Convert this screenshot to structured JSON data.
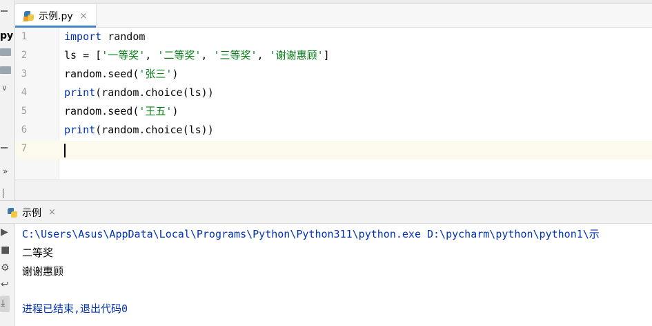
{
  "sidebar": {
    "project_label": "py"
  },
  "editor": {
    "tab": {
      "label": "示例.py",
      "close": "×"
    },
    "lines": [
      {
        "num": "1",
        "parts": [
          {
            "t": "import",
            "c": "kw"
          },
          {
            "t": " random",
            "c": ""
          }
        ]
      },
      {
        "num": "2",
        "parts": [
          {
            "t": "ls = [",
            "c": ""
          },
          {
            "t": "'一等奖'",
            "c": "str"
          },
          {
            "t": ", ",
            "c": ""
          },
          {
            "t": "'二等奖'",
            "c": "str"
          },
          {
            "t": ", ",
            "c": ""
          },
          {
            "t": "'三等奖'",
            "c": "str"
          },
          {
            "t": ", ",
            "c": ""
          },
          {
            "t": "'谢谢惠顾'",
            "c": "str"
          },
          {
            "t": "]",
            "c": ""
          }
        ]
      },
      {
        "num": "3",
        "parts": [
          {
            "t": "random.seed(",
            "c": ""
          },
          {
            "t": "'张三'",
            "c": "str"
          },
          {
            "t": ")",
            "c": ""
          }
        ]
      },
      {
        "num": "4",
        "parts": [
          {
            "t": "print",
            "c": "kw"
          },
          {
            "t": "(random.choice(ls))",
            "c": ""
          }
        ]
      },
      {
        "num": "5",
        "parts": [
          {
            "t": "random.seed(",
            "c": ""
          },
          {
            "t": "'王五'",
            "c": "str"
          },
          {
            "t": ")",
            "c": ""
          }
        ]
      },
      {
        "num": "6",
        "parts": [
          {
            "t": "print",
            "c": "kw"
          },
          {
            "t": "(random.choice(ls))",
            "c": ""
          }
        ]
      },
      {
        "num": "7",
        "parts": []
      }
    ]
  },
  "run": {
    "tab": {
      "label": "示例",
      "close": "×"
    },
    "console": {
      "command": "C:\\Users\\Asus\\AppData\\Local\\Programs\\Python\\Python311\\python.exe D:\\pycharm\\python\\python1\\示",
      "output": [
        "二等奖",
        "谢谢惠顾"
      ],
      "exit_message": "进程已结束,退出代码0"
    }
  },
  "colors": {
    "keyword": "#0033b3",
    "string": "#067d17",
    "current_line": "#fcfaed",
    "tab_accent": "#4083c9"
  }
}
